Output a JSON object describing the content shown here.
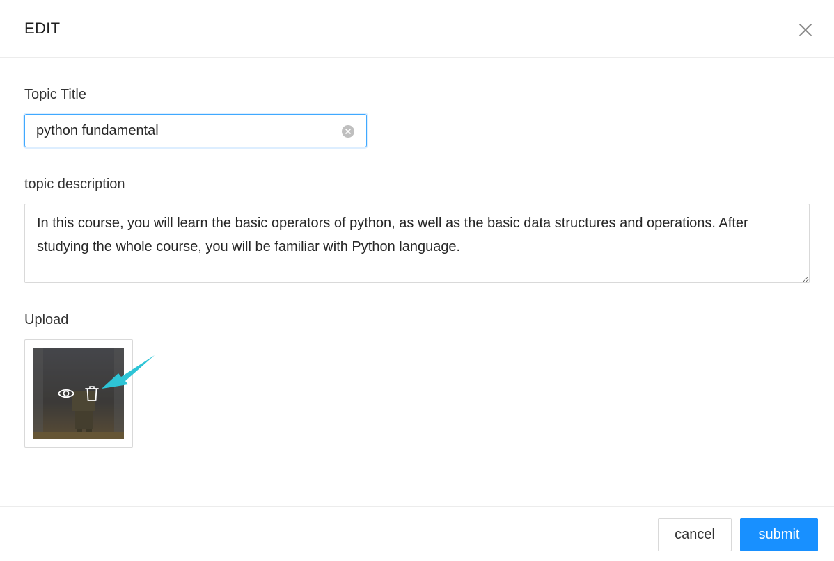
{
  "dialog": {
    "title": "EDIT"
  },
  "form": {
    "topic_title": {
      "label": "Topic Title",
      "value": "python fundamental"
    },
    "topic_description": {
      "label": "topic description",
      "value": "In this course, you will learn the basic operators of python, as well as the basic data structures and operations. After studying the whole course, you will be familiar with Python language."
    },
    "upload": {
      "label": "Upload"
    }
  },
  "footer": {
    "cancel_label": "cancel",
    "submit_label": "submit"
  },
  "colors": {
    "primary": "#1890ff",
    "annotation_arrow": "#2ec4d6"
  },
  "icons": {
    "close": "close-icon",
    "clear": "clear-circle-icon",
    "preview": "eye-icon",
    "delete": "trash-icon"
  }
}
